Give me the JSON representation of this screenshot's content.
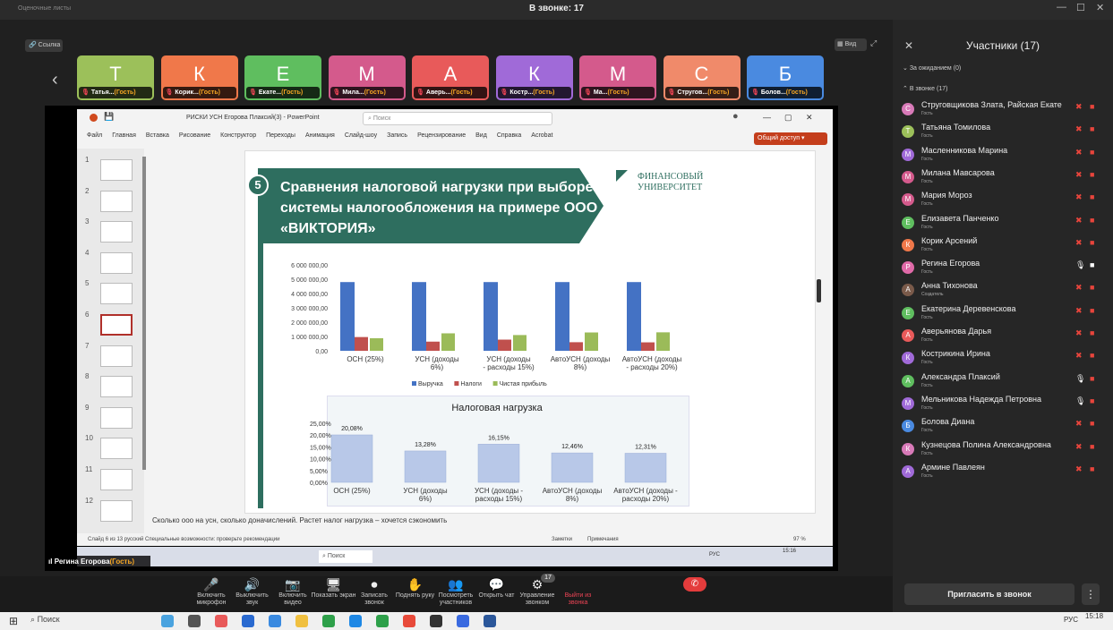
{
  "window": {
    "title": "В звонке: 17",
    "bg_title": "Оценочные листы"
  },
  "toolbar": {
    "link_label": "Ссылка",
    "view_label": "Вид"
  },
  "tiles": [
    {
      "letter": "Т",
      "name": "Татья...",
      "guest": "(Гость)",
      "color": "#9cc05a"
    },
    {
      "letter": "К",
      "name": "Корик...",
      "guest": "(Гость)",
      "color": "#f0784a"
    },
    {
      "letter": "Е",
      "name": "Екате...",
      "guest": "(Гость)",
      "color": "#5fbe5f"
    },
    {
      "letter": "М",
      "name": "Мила...",
      "guest": "(Гость)",
      "color": "#d45a8c"
    },
    {
      "letter": "А",
      "name": "Аверь...",
      "guest": "(Гость)",
      "color": "#e85a5a"
    },
    {
      "letter": "К",
      "name": "Костр...",
      "guest": "(Гость)",
      "color": "#a06ad8"
    },
    {
      "letter": "М",
      "name": "Ма...",
      "guest": "(Гость)",
      "color": "#d45a8c"
    },
    {
      "letter": "С",
      "name": "Стругов...",
      "guest": "(Гость)",
      "color": "#f08a6a"
    },
    {
      "letter": "Б",
      "name": "Болов...",
      "guest": "(Гость)",
      "color": "#4a8ae0"
    }
  ],
  "ppt": {
    "filename": "РИСКИ УСН Егорова Плаксий(3)  -  PowerPoint",
    "search": "Поиск",
    "share": "Общий доступ",
    "menu": [
      "Файл",
      "Главная",
      "Вставка",
      "Рисование",
      "Конструктор",
      "Переходы",
      "Анимация",
      "Слайд-шоу",
      "Запись",
      "Рецензирование",
      "Вид",
      "Справка",
      "Acrobat"
    ],
    "note": "Сколько ооо на усн, сколько доначислений. Растет налог нагрузка – хочется сэкономить",
    "status": "Слайд 6 из 13    русский    Специальные возможности: проверьте рекомендации",
    "zoom": "97 %",
    "comments": "Заметки",
    "notes_btn": "Примечания"
  },
  "slide": {
    "number": "5",
    "title": "Сравнения налоговой нагрузки при выборе системы налогообложения на примере ООО «ВИКТОРИЯ»",
    "logo": "ФИНАНСОВЫЙ УНИВЕРСИТЕТ"
  },
  "chart_data": [
    {
      "type": "bar",
      "categories": [
        "ОСН (25%)",
        "УСН (доходы 6%)",
        "УСН (доходы - расходы 15%)",
        "АвтоУСН (доходы 8%)",
        "АвтоУСН (доходы - расходы 20%)"
      ],
      "series": [
        {
          "name": "Выручка",
          "values": [
            4800000,
            4800000,
            4800000,
            4800000,
            4800000
          ],
          "color": "#4472c4"
        },
        {
          "name": "Налоги",
          "values": [
            960000,
            640000,
            780000,
            600000,
            590000
          ],
          "color": "#c0504d"
        },
        {
          "name": "Чистая прибыль",
          "values": [
            880000,
            1220000,
            1100000,
            1280000,
            1290000
          ],
          "color": "#9bbb59"
        }
      ],
      "yticks": [
        "6 000 000,00",
        "5 000 000,00",
        "4 000 000,00",
        "3 000 000,00",
        "2 000 000,00",
        "1 000 000,00",
        "0,00"
      ],
      "ylim": [
        0,
        6000000
      ],
      "legend": "bottom"
    },
    {
      "type": "bar",
      "title": "Налоговая нагрузка",
      "categories": [
        "ОСН (25%)",
        "УСН (доходы 6%)",
        "УСН (доходы - расходы 15%)",
        "АвтоУСН (доходы 8%)",
        "АвтоУСН (доходы - расходы 20%)"
      ],
      "values": [
        20.08,
        13.28,
        16.15,
        12.46,
        12.31
      ],
      "labels": [
        "20,08%",
        "13,28%",
        "16,15%",
        "12,46%",
        "12,31%"
      ],
      "yticks": [
        "25,00%",
        "20,00%",
        "15,00%",
        "10,00%",
        "5,00%",
        "0,00%"
      ],
      "ylim": [
        0,
        25
      ]
    }
  ],
  "speaker": {
    "name": "Регина Егорова",
    "guest": "(Гость)"
  },
  "controls": [
    {
      "icon": "🎤",
      "label": "Включить микрофон"
    },
    {
      "icon": "🔊",
      "label": "Выключить звук"
    },
    {
      "icon": "📷",
      "label": "Включить видео"
    },
    {
      "icon": "🖥",
      "label": "Показать экран"
    },
    {
      "icon": "⏺",
      "label": "Записать звонок"
    },
    {
      "icon": "✋",
      "label": "Поднять руку"
    },
    {
      "icon": "👥",
      "label": "Посмотреть участников"
    },
    {
      "icon": "💬",
      "label": "Открыть чат"
    },
    {
      "icon": "⚙",
      "label": "Управление звонком"
    },
    {
      "icon": "",
      "label": "Выйти из звонка"
    }
  ],
  "participants_count": "17",
  "panel": {
    "title": "Участники (17)",
    "waiting": "За ожиданием (0)",
    "incall": "В звонке (17)",
    "invite": "Пригласить в звонок"
  },
  "participants": [
    {
      "name": "Струговщикова Злата, Райская Екате",
      "role": "Гость",
      "color": "#d87ab8",
      "letter": "С"
    },
    {
      "name": "Татьяна Томилова",
      "role": "Гость",
      "color": "#9cc05a",
      "letter": "Т"
    },
    {
      "name": "Масленникова Марина",
      "role": "Гость",
      "color": "#a06ad8",
      "letter": "М"
    },
    {
      "name": "Милана Мавсарова",
      "role": "Гость",
      "color": "#d45a8c",
      "letter": "М"
    },
    {
      "name": "Мария Мороз",
      "role": "Гость",
      "color": "#d45a8c",
      "letter": "М"
    },
    {
      "name": "Елизавета Панченко",
      "role": "Гость",
      "color": "#5fbe5f",
      "letter": "Е"
    },
    {
      "name": "Корик Арсений",
      "role": "Гость",
      "color": "#f0784a",
      "letter": "К"
    },
    {
      "name": "Регина Егорова",
      "role": "Гость",
      "color": "#e06aa8",
      "letter": "Р"
    },
    {
      "name": "Анна Тихонова",
      "role": "Создатель",
      "color": "#7a5a4a",
      "letter": "А"
    },
    {
      "name": "Екатерина Деревенскова",
      "role": "Гость",
      "color": "#5fbe5f",
      "letter": "Е"
    },
    {
      "name": "Аверьянова Дарья",
      "role": "Гость",
      "color": "#e85a5a",
      "letter": "А"
    },
    {
      "name": "Кострикина Ирина",
      "role": "Гость",
      "color": "#a06ad8",
      "letter": "К"
    },
    {
      "name": "Александра Плаксий",
      "role": "Гость",
      "color": "#5fbe5f",
      "letter": "А"
    },
    {
      "name": "Мельникова Надежда Петровна",
      "role": "Гость",
      "color": "#a06ad8",
      "letter": "М"
    },
    {
      "name": "Болова Диана",
      "role": "Гость",
      "color": "#4a8ae0",
      "letter": "Б"
    },
    {
      "name": "Кузнецова Полина Александровна",
      "role": "Гость",
      "color": "#d87ab8",
      "letter": "К"
    },
    {
      "name": "Армине Павлеян",
      "role": "Гость",
      "color": "#a06ad8",
      "letter": "А"
    }
  ],
  "taskbar": {
    "search": "Поиск",
    "clock": "15:18",
    "lang": "РУС",
    "inner_clock": "15:16",
    "inner_lang": "РУС"
  }
}
